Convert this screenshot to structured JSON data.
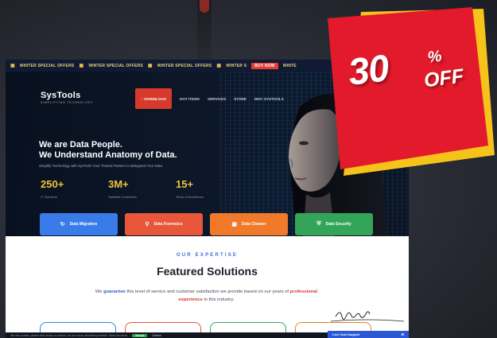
{
  "ticker": {
    "items": [
      "WINTER SPECIAL OFFERS",
      "WINTER SPECIAL OFFERS",
      "WINTER SPECIAL OFFERS",
      "WINTER S"
    ],
    "cta": "BUY NOW",
    "cta_tail": "WINTE"
  },
  "logo": {
    "brand": "SysTools",
    "tagline": "SIMPLIFYING TECHNOLOGY"
  },
  "nav": {
    "download": "DOWNLOAD",
    "links": [
      "HOT ITEMS",
      "SERVICES",
      "STORE",
      "WHY SYSTOOLS"
    ]
  },
  "hero": {
    "headline_1": "We are Data People.",
    "headline_2": "We Understand Anatomy of Data.",
    "subline": "Simplify Technology with SysTools Your Trusted Partner to Safeguard Your Data",
    "stats": [
      {
        "num": "250+",
        "label": "IT Solutions"
      },
      {
        "num": "3M+",
        "label": "Satisfied Customers"
      },
      {
        "num": "15+",
        "label": "Years of Excellence"
      }
    ],
    "pills": [
      {
        "label": "Data Migration",
        "icon": "refresh-icon",
        "color": "#3a7bea"
      },
      {
        "label": "Data Forensics",
        "icon": "search-icon",
        "color": "#e8573a"
      },
      {
        "label": "Data Cleaner",
        "icon": "folder-icon",
        "color": "#f07a2a"
      },
      {
        "label": "Data Security",
        "icon": "shield-icon",
        "color": "#33a558"
      }
    ]
  },
  "expertise": {
    "eyebrow": "OUR EXPERTISE",
    "title": "Featured Solutions",
    "desc_1": "We ",
    "desc_hl": "guarantee",
    "desc_2": " this level of service and customer satisfaction we provide based on our years of ",
    "desc_hr": "professional experience",
    "desc_3": " in this industry."
  },
  "cookie": {
    "text": "We use cookies, please click accept or decline, we are not an advertising website. Read the terms",
    "accept": "Accept",
    "decline": "Decline"
  },
  "chat": {
    "label": "Live Chat Support"
  },
  "discount": {
    "value": "30",
    "percent": "%",
    "off": "OFF"
  },
  "colors": {
    "accent_red": "#d7392b",
    "badge_red": "#e31a2b",
    "badge_yellow": "#f6c31a",
    "stat_yellow": "#f2c23c",
    "link_blue": "#3c6fd6"
  }
}
